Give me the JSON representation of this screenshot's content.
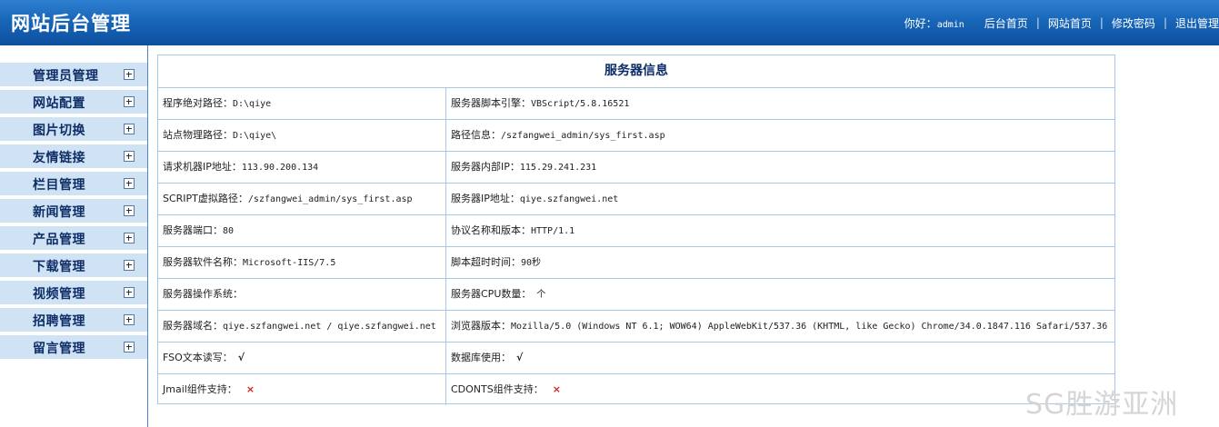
{
  "header": {
    "title": "网站后台管理",
    "greeting": "你好：",
    "username": "admin",
    "links": [
      "后台首页",
      "网站首页",
      "修改密码",
      "退出管理"
    ],
    "separator": "|"
  },
  "sidebar": {
    "items": [
      "管理员管理",
      "网站配置",
      "图片切换",
      "友情链接",
      "栏目管理",
      "新闻管理",
      "产品管理",
      "下载管理",
      "视频管理",
      "招聘管理",
      "留言管理"
    ]
  },
  "server_info": {
    "title": "服务器信息",
    "rows": [
      [
        {
          "label": "程序绝对路径：",
          "value": "D:\\qiye"
        },
        {
          "label": "服务器脚本引擎：",
          "value": "VBScript/5.8.16521"
        }
      ],
      [
        {
          "label": "站点物理路径：",
          "value": "D:\\qiye\\"
        },
        {
          "label": "路径信息：",
          "value": "/szfangwei_admin/sys_first.asp"
        }
      ],
      [
        {
          "label": "请求机器IP地址：",
          "value": "113.90.200.134"
        },
        {
          "label": "服务器内部IP：",
          "value": "115.29.241.231"
        }
      ],
      [
        {
          "label": "SCRIPT虚拟路径：",
          "value": "/szfangwei_admin/sys_first.asp"
        },
        {
          "label": "服务器IP地址：",
          "value": "qiye.szfangwei.net"
        }
      ],
      [
        {
          "label": "服务器端口：",
          "value": "80"
        },
        {
          "label": "协议名称和版本：",
          "value": "HTTP/1.1"
        }
      ],
      [
        {
          "label": "服务器软件名称：",
          "value": "Microsoft-IIS/7.5"
        },
        {
          "label": "脚本超时时间：",
          "value": "90秒"
        }
      ],
      [
        {
          "label": "服务器操作系统：",
          "value": ""
        },
        {
          "label": "服务器CPU数量：",
          "value": " 个"
        }
      ],
      [
        {
          "label": "服务器域名：",
          "value": "qiye.szfangwei.net / qiye.szfangwei.net"
        },
        {
          "label": "浏览器版本：",
          "value": "Mozilla/5.0 (Windows NT 6.1; WOW64) AppleWebKit/537.36 (KHTML, like Gecko) Chrome/34.0.1847.116 Safari/537.36"
        }
      ],
      [
        {
          "label": "FSO文本读写：",
          "mark": "√"
        },
        {
          "label": "数据库使用：",
          "mark": "√"
        }
      ],
      [
        {
          "label": "Jmail组件支持：",
          "mark": "×"
        },
        {
          "label": "CDONTS组件支持：",
          "mark": "×"
        }
      ]
    ]
  },
  "watermark": "SG胜游亚洲"
}
